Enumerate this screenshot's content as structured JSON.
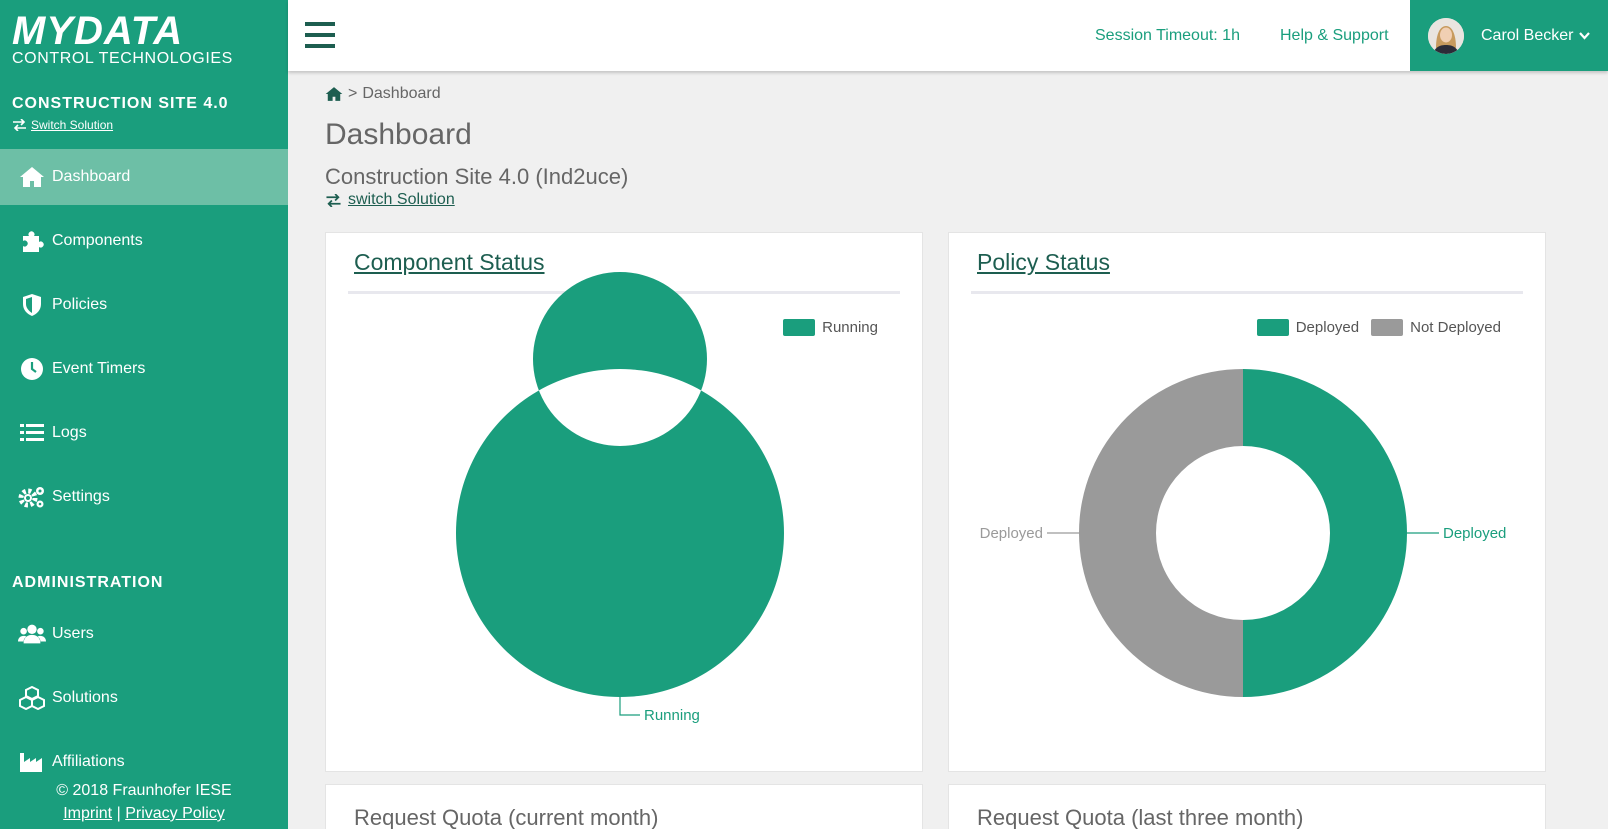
{
  "sidebar": {
    "logo_brand": "MYDATA",
    "logo_tag": "CONTROL TECHNOLOGIES",
    "solution_title": "CONSTRUCTION SITE 4.0",
    "switch_solution": "Switch Solution",
    "items": [
      {
        "label": "Dashboard",
        "icon": "home-icon",
        "active": true
      },
      {
        "label": "Components",
        "icon": "puzzle-icon"
      },
      {
        "label": "Policies",
        "icon": "shield-icon"
      },
      {
        "label": "Event Timers",
        "icon": "clock-icon"
      },
      {
        "label": "Logs",
        "icon": "list-icon"
      },
      {
        "label": "Settings",
        "icon": "gears-icon"
      }
    ],
    "admin_title": "ADMINISTRATION",
    "admin_items": [
      {
        "label": "Users",
        "icon": "users-icon"
      },
      {
        "label": "Solutions",
        "icon": "cubes-icon"
      },
      {
        "label": "Affiliations",
        "icon": "industry-icon"
      }
    ],
    "footer": {
      "copyright": "© 2018 Fraunhofer IESE",
      "imprint": "Imprint",
      "separator": "|",
      "privacy": "Privacy Policy"
    }
  },
  "header": {
    "session_timeout": "Session Timeout: 1h",
    "help": "Help & Support",
    "user_name": "Carol Becker"
  },
  "main": {
    "breadcrumb_sep": ">",
    "breadcrumb_current": "Dashboard",
    "page_title": "Dashboard",
    "solution_name": "Construction Site 4.0 (Ind2uce)",
    "switch_solution": "switch Solution"
  },
  "cards": {
    "component_status": "Component Status",
    "policy_status": "Policy Status",
    "quota_current": "Request Quota (current month)",
    "quota_three": "Request Quota (last three month)"
  },
  "colors": {
    "primary": "#1a9e7d",
    "dark": "#1d5e50",
    "grey": "#9a9a9a"
  },
  "chart_data": [
    {
      "type": "pie",
      "title": "Component Status",
      "categories": [
        "Running"
      ],
      "values": [
        1
      ],
      "legend": [
        "Running"
      ],
      "slice_labels": [
        "Running"
      ]
    },
    {
      "type": "pie",
      "title": "Policy Status",
      "categories": [
        "Deployed",
        "Not Deployed"
      ],
      "values": [
        1,
        1
      ],
      "legend": [
        "Deployed",
        "Not Deployed"
      ],
      "slice_labels": [
        "Deployed",
        "Deployed"
      ]
    }
  ]
}
